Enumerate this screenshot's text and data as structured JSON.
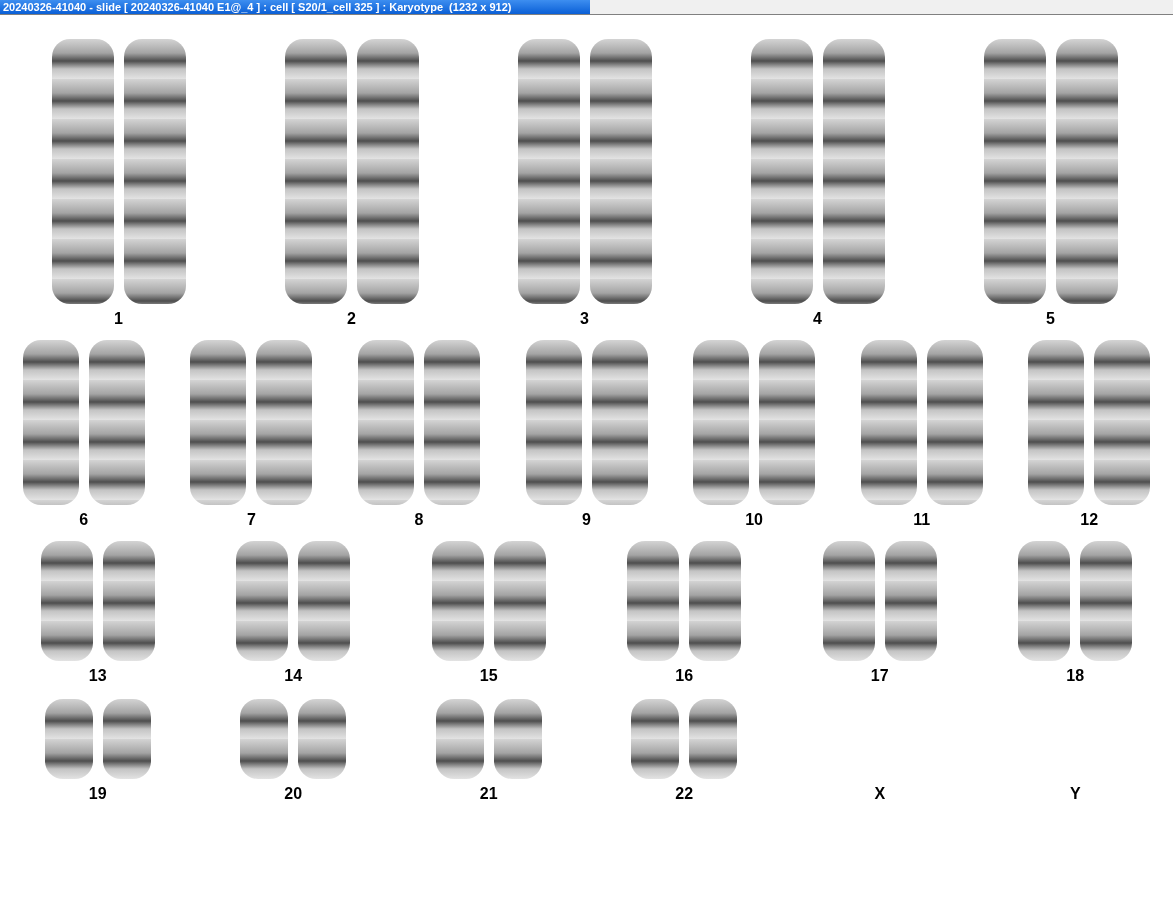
{
  "window": {
    "title": "20240326-41040 - slide [ 20240326-41040 E1@_4 ] : cell [ S20/1_cell 325 ] : Karyotype  (1232 x 912)"
  },
  "rows": [
    {
      "items": [
        {
          "label": "1",
          "kind": "pair"
        },
        {
          "label": "2",
          "kind": "pair"
        },
        {
          "label": "3",
          "kind": "pair"
        },
        {
          "label": "4",
          "kind": "pair"
        },
        {
          "label": "5",
          "kind": "pair"
        }
      ]
    },
    {
      "items": [
        {
          "label": "6",
          "kind": "pair"
        },
        {
          "label": "7",
          "kind": "pair"
        },
        {
          "label": "8",
          "kind": "pair"
        },
        {
          "label": "9",
          "kind": "pair"
        },
        {
          "label": "10",
          "kind": "pair"
        },
        {
          "label": "11",
          "kind": "pair"
        },
        {
          "label": "12",
          "kind": "pair"
        }
      ]
    },
    {
      "items": [
        {
          "label": "13",
          "kind": "pair"
        },
        {
          "label": "14",
          "kind": "pair"
        },
        {
          "label": "15",
          "kind": "pair"
        },
        {
          "label": "16",
          "kind": "pair"
        },
        {
          "label": "17",
          "kind": "pair"
        },
        {
          "label": "18",
          "kind": "pair"
        }
      ]
    },
    {
      "items": [
        {
          "label": "19",
          "kind": "pair"
        },
        {
          "label": "20",
          "kind": "pair"
        },
        {
          "label": "21",
          "kind": "pair"
        },
        {
          "label": "22",
          "kind": "pair"
        },
        {
          "label": "X",
          "kind": "empty"
        },
        {
          "label": "Y",
          "kind": "empty"
        }
      ]
    }
  ]
}
